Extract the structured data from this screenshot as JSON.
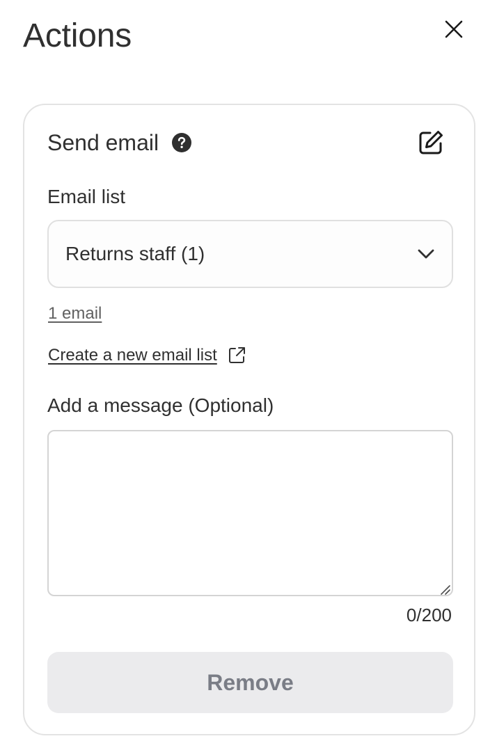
{
  "panel": {
    "title": "Actions",
    "close_icon": "close-icon"
  },
  "action_card": {
    "title": "Send email",
    "help_icon": "question-circle-icon",
    "edit_icon": "edit-icon",
    "email_list": {
      "label": "Email list",
      "selected_value": "Returns staff (1)",
      "dropdown_icon": "chevron-down-icon",
      "count_link": "1 email"
    },
    "create_link": {
      "label": "Create a new email list",
      "icon": "external-link-icon"
    },
    "message": {
      "label": "Add a message (Optional)",
      "value": "",
      "placeholder": "",
      "counter": "0/200"
    },
    "remove_button": "Remove"
  },
  "colors": {
    "text": "#303030",
    "muted_text": "#616161",
    "border": "#e3e3e3",
    "disabled_button_bg": "#ebebed",
    "disabled_button_text": "#7a7d86"
  }
}
